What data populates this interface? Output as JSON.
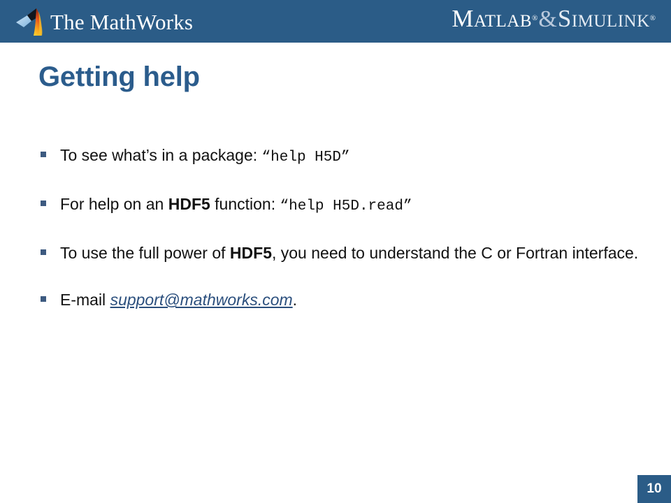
{
  "header": {
    "logo_icon": "matlab-membrane-icon",
    "company_name": "The MathWorks",
    "product_matlab": "Matlab",
    "product_simulink": "Simulink",
    "ampersand": "&",
    "registered_mark": "®",
    "background_color": "#2b5c87"
  },
  "slide": {
    "title": "Getting help",
    "title_color": "#2b5c8c",
    "bullet_marker_color": "#3d5a80",
    "bullets": [
      {
        "id": "bullet-package-help",
        "lead": "To see what’s in a package: ",
        "open_quote": "“",
        "code": "help H5D",
        "close_quote": "”",
        "tail": ""
      },
      {
        "id": "bullet-function-help",
        "lead": "For help on an ",
        "bold": "HDF5",
        "lead2": " function: ",
        "open_quote": "“",
        "code": "help H5D.read",
        "close_quote": "”",
        "tail": ""
      },
      {
        "id": "bullet-full-power",
        "lead": "To use the full power of ",
        "bold": "HDF5",
        "lead2": ", you need to understand the C or Fortran interface."
      },
      {
        "id": "bullet-email-support",
        "lead": "E-mail ",
        "link": "support@mathworks.com",
        "link_color": "#2b4f7d",
        "tail": "."
      }
    ]
  },
  "footer": {
    "page_number": "10",
    "badge_color": "#2b5c87"
  }
}
